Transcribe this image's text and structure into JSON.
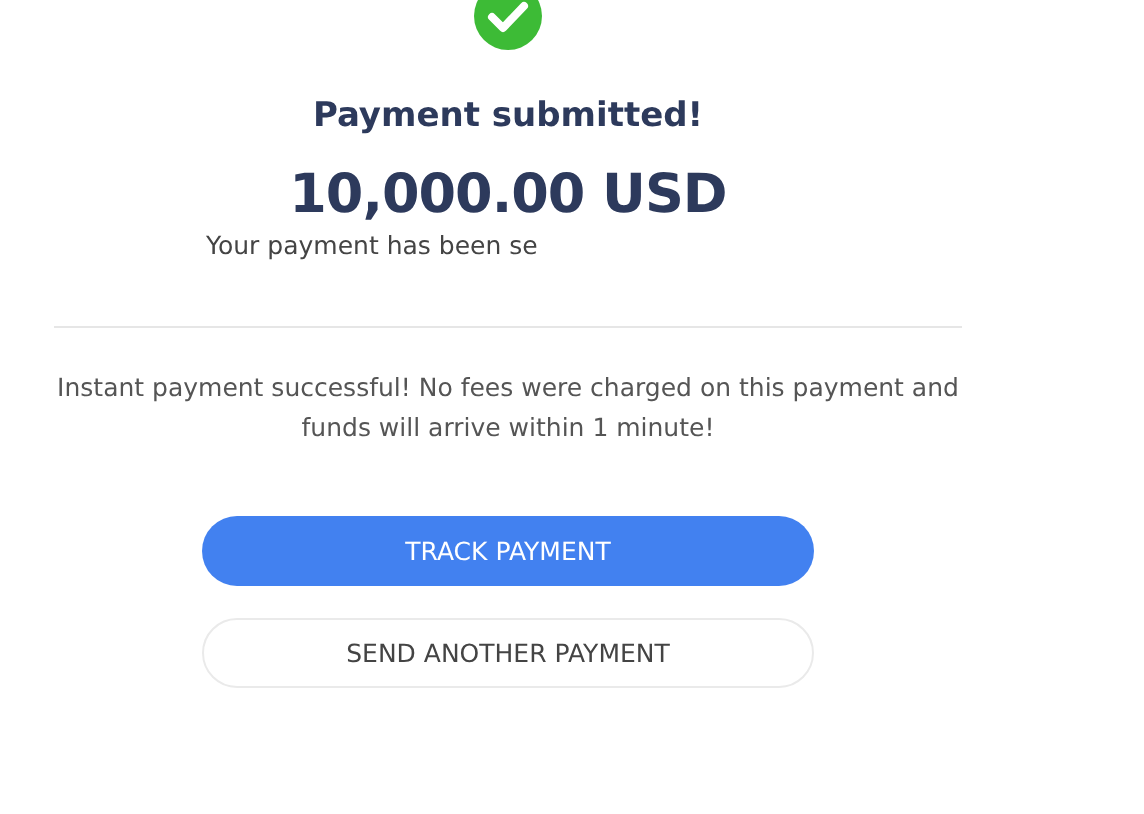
{
  "title": "Payment submitted!",
  "amount": "10,000.00 USD",
  "note": "Your payment has been se",
  "message": "Instant payment successful! No fees were charged on this payment and funds will arrive within 1 minute!",
  "buttons": [
    {
      "label": "TRACK PAYMENT",
      "kind": "primary"
    },
    {
      "label": "SEND ANOTHER PAYMENT",
      "kind": "secondary"
    }
  ]
}
